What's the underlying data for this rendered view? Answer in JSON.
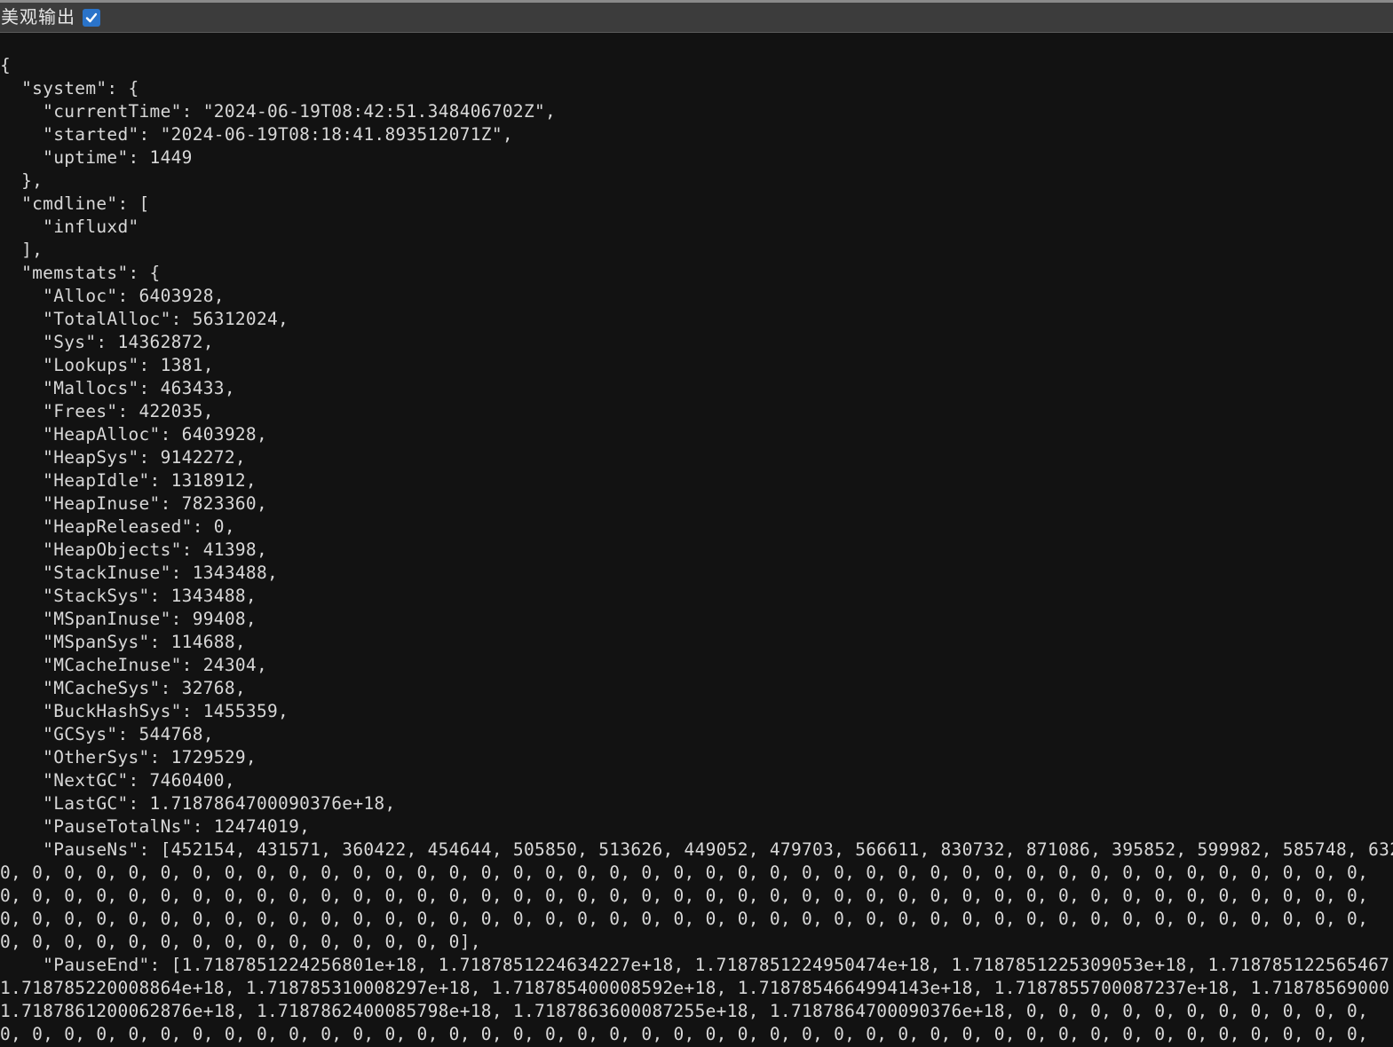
{
  "toolbar": {
    "pretty_print_label": "美观输出",
    "pretty_print_checked": true
  },
  "output": {
    "lines": [
      "{",
      "  \"system\": {",
      "    \"currentTime\": \"2024-06-19T08:42:51.348406702Z\",",
      "    \"started\": \"2024-06-19T08:18:41.893512071Z\",",
      "    \"uptime\": 1449",
      "  },",
      "  \"cmdline\": [",
      "    \"influxd\"",
      "  ],",
      "  \"memstats\": {",
      "    \"Alloc\": 6403928,",
      "    \"TotalAlloc\": 56312024,",
      "    \"Sys\": 14362872,",
      "    \"Lookups\": 1381,",
      "    \"Mallocs\": 463433,",
      "    \"Frees\": 422035,",
      "    \"HeapAlloc\": 6403928,",
      "    \"HeapSys\": 9142272,",
      "    \"HeapIdle\": 1318912,",
      "    \"HeapInuse\": 7823360,",
      "    \"HeapReleased\": 0,",
      "    \"HeapObjects\": 41398,",
      "    \"StackInuse\": 1343488,",
      "    \"StackSys\": 1343488,",
      "    \"MSpanInuse\": 99408,",
      "    \"MSpanSys\": 114688,",
      "    \"MCacheInuse\": 24304,",
      "    \"MCacheSys\": 32768,",
      "    \"BuckHashSys\": 1455359,",
      "    \"GCSys\": 544768,",
      "    \"OtherSys\": 1729529,",
      "    \"NextGC\": 7460400,",
      "    \"LastGC\": 1.7187864700090376e+18,",
      "    \"PauseTotalNs\": 12474019,",
      "    \"PauseNs\": [452154, 431571, 360422, 454644, 505850, 513626, 449052, 479703, 566611, 830732, 871086, 395852, 599982, 585748, 632",
      "0, 0, 0, 0, 0, 0, 0, 0, 0, 0, 0, 0, 0, 0, 0, 0, 0, 0, 0, 0, 0, 0, 0, 0, 0, 0, 0, 0, 0, 0, 0, 0, 0, 0, 0, 0, 0, 0, 0, 0, 0, 0, 0,",
      "0, 0, 0, 0, 0, 0, 0, 0, 0, 0, 0, 0, 0, 0, 0, 0, 0, 0, 0, 0, 0, 0, 0, 0, 0, 0, 0, 0, 0, 0, 0, 0, 0, 0, 0, 0, 0, 0, 0, 0, 0, 0, 0,",
      "0, 0, 0, 0, 0, 0, 0, 0, 0, 0, 0, 0, 0, 0, 0, 0, 0, 0, 0, 0, 0, 0, 0, 0, 0, 0, 0, 0, 0, 0, 0, 0, 0, 0, 0, 0, 0, 0, 0, 0, 0, 0, 0,",
      "0, 0, 0, 0, 0, 0, 0, 0, 0, 0, 0, 0, 0, 0, 0],",
      "    \"PauseEnd\": [1.7187851224256801e+18, 1.7187851224634227e+18, 1.7187851224950474e+18, 1.7187851225309053e+18, 1.718785122565467",
      "1.718785220008864e+18, 1.718785310008297e+18, 1.718785400008592e+18, 1.7187854664994143e+18, 1.7187855700087237e+18, 1.71878569000",
      "1.7187861200062876e+18, 1.7187862400085798e+18, 1.7187863600087255e+18, 1.7187864700090376e+18, 0, 0, 0, 0, 0, 0, 0, 0, 0, 0, 0,",
      "0, 0, 0, 0, 0, 0, 0, 0, 0, 0, 0, 0, 0, 0, 0, 0, 0, 0, 0, 0, 0, 0, 0, 0, 0, 0, 0, 0, 0, 0, 0, 0, 0, 0, 0, 0, 0, 0, 0, 0, 0, 0, 0,"
    ]
  }
}
